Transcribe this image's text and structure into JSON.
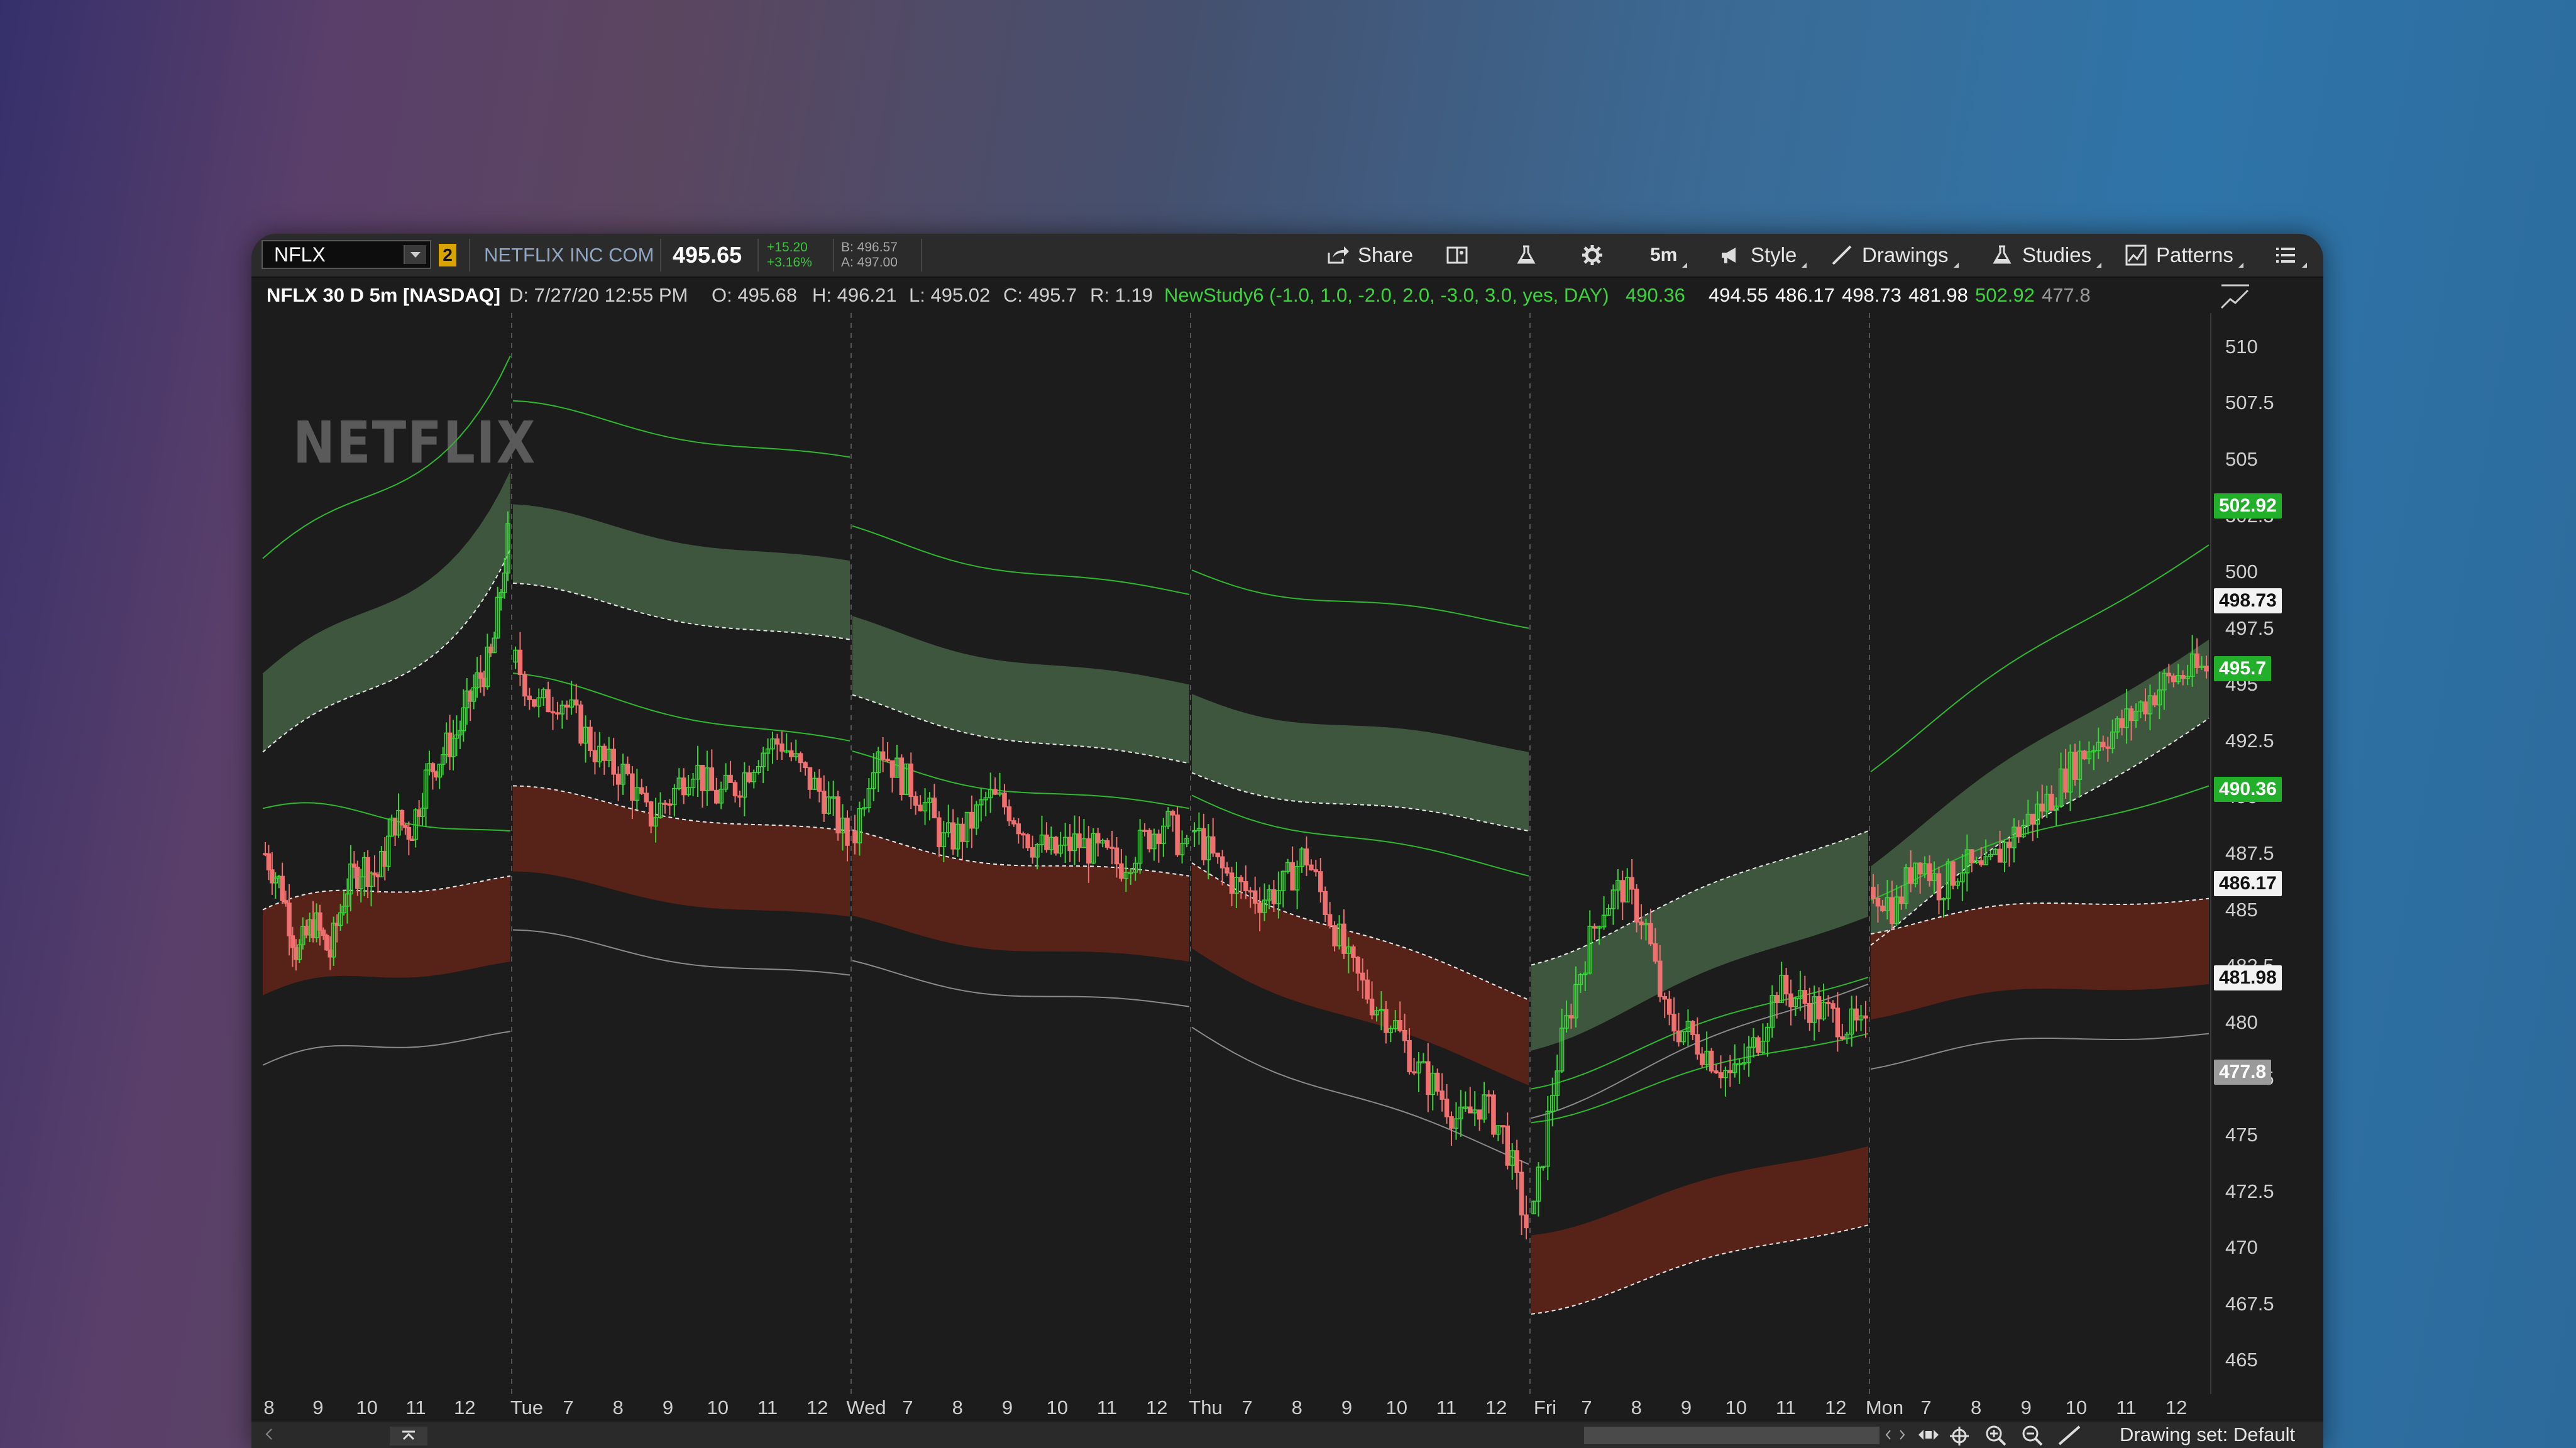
{
  "toolbar": {
    "symbol": "NFLX",
    "link_badge": "2",
    "company": "NETFLIX INC COM",
    "last_price": "495.65",
    "change": "+15.20",
    "change_pct": "+3.16%",
    "bid": "B: 496.57",
    "ask": "A: 497.00",
    "share_label": "Share",
    "timeframe": "5m",
    "style_label": "Style",
    "drawings_label": "Drawings",
    "studies_label": "Studies",
    "patterns_label": "Patterns"
  },
  "infobar": {
    "title": "NFLX 30 D 5m [NASDAQ]",
    "date": "D: 7/27/20 12:55 PM",
    "open": "O: 495.68",
    "high": "H: 496.21",
    "low": "L: 495.02",
    "close": "C: 495.7",
    "range": "R: 1.19",
    "study": "NewStudy6 (-1.0, 1.0, -2.0, 2.0, -3.0, 3.0, yes, DAY)",
    "study_values": [
      "490.36",
      "494.55",
      "486.17",
      "498.73",
      "481.98",
      "502.92",
      "477.8"
    ]
  },
  "logo_text": "NETFLIX",
  "price_axis": {
    "ticks": [
      "510",
      "507.5",
      "505",
      "502.5",
      "500",
      "497.5",
      "495",
      "492.5",
      "490",
      "487.5",
      "485",
      "482.5",
      "480",
      "477.5",
      "475",
      "472.5",
      "470",
      "467.5",
      "465"
    ],
    "tags": [
      {
        "value": "502.92",
        "bg": "#22b02a",
        "fg": "#ffffff"
      },
      {
        "value": "498.73",
        "bg": "#f2f2f2",
        "fg": "#111111"
      },
      {
        "value": "495.7",
        "bg": "#22b02a",
        "fg": "#ffffff"
      },
      {
        "value": "490.36",
        "bg": "#22b02a",
        "fg": "#ffffff"
      },
      {
        "value": "486.17",
        "bg": "#f2f2f2",
        "fg": "#111111"
      },
      {
        "value": "481.98",
        "bg": "#f2f2f2",
        "fg": "#111111"
      },
      {
        "value": "477.8",
        "bg": "#9a9a9a",
        "fg": "#ffffff"
      }
    ]
  },
  "time_axis": [
    "8",
    "9",
    "10",
    "11",
    "12",
    "Tue",
    "7",
    "8",
    "9",
    "10",
    "11",
    "12",
    "Wed",
    "7",
    "8",
    "9",
    "10",
    "11",
    "12",
    "Thu",
    "7",
    "8",
    "9",
    "10",
    "11",
    "12",
    "Fri",
    "7",
    "8",
    "9",
    "10",
    "11",
    "12",
    "Mon",
    "7",
    "8",
    "9",
    "10",
    "11",
    "12"
  ],
  "bottom": {
    "drawing_set": "Drawing set: Default"
  },
  "chart_data": {
    "type": "line",
    "ylim": [
      463.5,
      511.5
    ],
    "sessions": [
      "Mon",
      "Tue",
      "Wed",
      "Thu",
      "Fri",
      "Mon"
    ],
    "close_path": [
      {
        "s": 0,
        "vals": [
          487.5,
          486,
          483,
          484.5,
          483,
          486,
          487,
          486.5,
          489,
          488.5,
          491,
          492,
          493,
          495,
          496.2,
          501.5
        ]
      },
      {
        "s": 1,
        "vals": [
          496,
          494,
          494.5,
          493,
          491.5,
          491,
          489,
          490,
          491.5,
          490,
          490.5,
          492,
          492.5,
          491,
          490,
          488
        ]
      },
      {
        "s": 2,
        "vals": [
          488.5,
          492.5,
          491,
          490,
          488,
          488.5,
          490,
          489.5,
          488,
          487.5,
          488,
          487.5,
          487,
          488,
          489,
          487.5
        ]
      },
      {
        "s": 3,
        "vals": [
          488.5,
          487,
          486,
          485.5,
          486,
          487.5,
          485,
          482.5,
          481,
          480,
          478,
          477,
          475.5,
          476.5,
          475,
          471
        ]
      },
      {
        "s": 4,
        "vals": [
          471.5,
          478,
          482,
          485,
          486,
          484.5,
          480,
          479.5,
          478.5,
          477.5,
          479,
          481.5,
          481,
          480.5,
          480,
          479.5
        ]
      },
      {
        "s": 5,
        "vals": [
          486,
          485,
          487.5,
          486,
          487,
          486.5,
          488,
          489,
          490,
          491.5,
          492.5,
          493,
          494,
          495,
          495.5,
          495.7
        ]
      }
    ]
  }
}
